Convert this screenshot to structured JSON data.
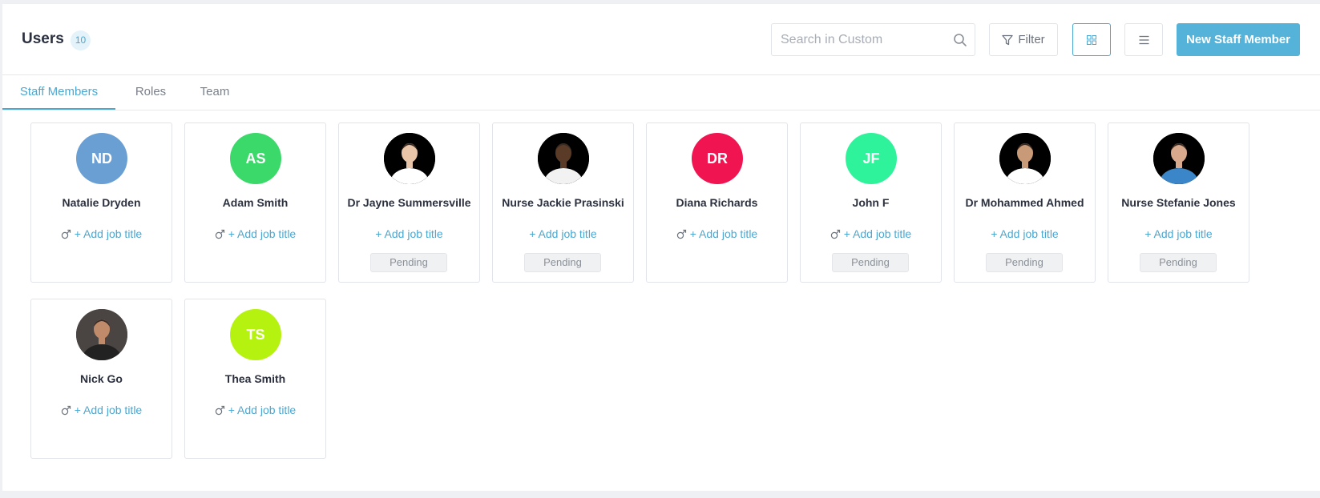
{
  "header": {
    "title": "Users",
    "count": "10",
    "search_placeholder": "Search in Custom",
    "filter_label": "Filter",
    "new_button_label": "New Staff Member"
  },
  "tabs": [
    {
      "label": "Staff Members",
      "active": true
    },
    {
      "label": "Roles",
      "active": false
    },
    {
      "label": "Team",
      "active": false
    }
  ],
  "add_job_label": "+ Add job title",
  "pending_label": "Pending",
  "users": [
    {
      "initials": "ND",
      "name": "Natalie Dryden",
      "avatar_color": "#6a9fd4",
      "photo": false,
      "gender_icon": true,
      "pending": false
    },
    {
      "initials": "AS",
      "name": "Adam Smith",
      "avatar_color": "#3bd86a",
      "photo": false,
      "gender_icon": true,
      "pending": false
    },
    {
      "initials": "",
      "name": "Dr Jayne Summersville",
      "avatar_color": "#000000",
      "photo": true,
      "gender_icon": false,
      "pending": true
    },
    {
      "initials": "",
      "name": "Nurse Jackie Prasinski",
      "avatar_color": "#000000",
      "photo": true,
      "gender_icon": false,
      "pending": true
    },
    {
      "initials": "DR",
      "name": "Diana Richards",
      "avatar_color": "#f01451",
      "photo": false,
      "gender_icon": true,
      "pending": false
    },
    {
      "initials": "JF",
      "name": "John F",
      "avatar_color": "#2ff39a",
      "photo": false,
      "gender_icon": true,
      "pending": true
    },
    {
      "initials": "",
      "name": "Dr Mohammed Ahmed",
      "avatar_color": "#000000",
      "photo": true,
      "gender_icon": false,
      "pending": true
    },
    {
      "initials": "",
      "name": "Nurse Stefanie Jones",
      "avatar_color": "#000000",
      "photo": true,
      "gender_icon": false,
      "pending": true
    },
    {
      "initials": "",
      "name": "Nick Go",
      "avatar_color": "#4a4542",
      "photo": true,
      "gender_icon": true,
      "pending": false
    },
    {
      "initials": "TS",
      "name": "Thea Smith",
      "avatar_color": "#b6f20f",
      "photo": false,
      "gender_icon": true,
      "pending": false
    }
  ]
}
